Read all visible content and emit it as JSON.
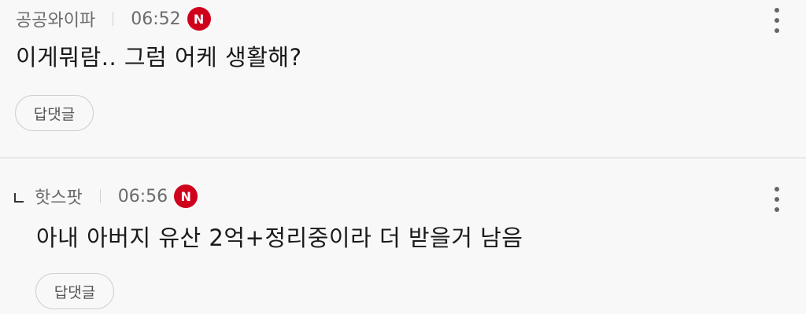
{
  "comments": [
    {
      "nickname": "공공와이파",
      "time": "06:52",
      "badge": "N",
      "text": "이게뭐람.. 그럼 어케 생활해?",
      "reply_label": "답댓글",
      "is_reply": false
    },
    {
      "nickname": "핫스팟",
      "time": "06:56",
      "badge": "N",
      "text": "아내 아버지 유산 2억+정리중이라 더 받을거 남음",
      "reply_label": "답댓글",
      "is_reply": true
    }
  ],
  "colors": {
    "badge": "#d0021b",
    "background": "#f8f8f8",
    "meta_text": "#6b6b6b"
  },
  "icons": {
    "badge": "new-badge-icon",
    "more": "more-vertical-icon",
    "reply_mark": "reply-corner-icon"
  }
}
